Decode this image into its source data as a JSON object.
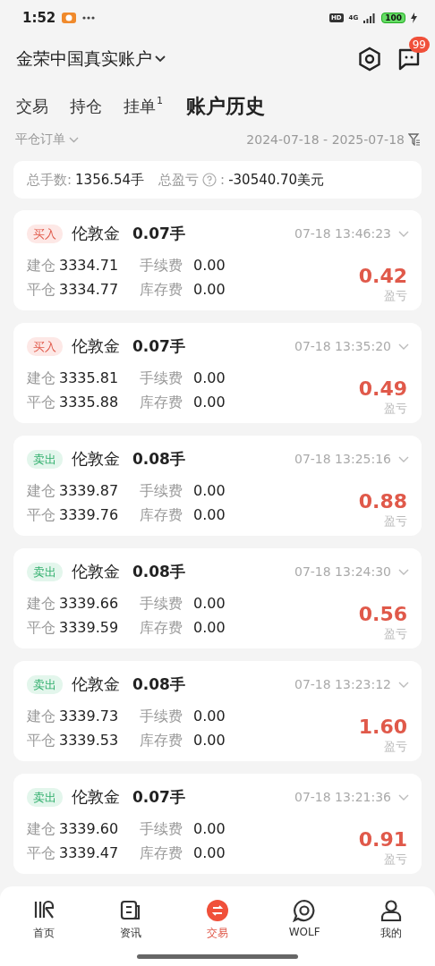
{
  "status_bar": {
    "time": "1:52",
    "hd": "HD",
    "network": "4G",
    "battery": "100"
  },
  "header": {
    "account": "金荣中国真实账户",
    "notification_badge": "99"
  },
  "tabs": [
    {
      "label": "交易",
      "selected": false
    },
    {
      "label": "持仓",
      "selected": false
    },
    {
      "label": "挂单",
      "selected": false,
      "badge": "1"
    },
    {
      "label": "账户历史",
      "selected": true
    }
  ],
  "filter": {
    "order_type": "平仓订单",
    "date_range": "2024-07-18 - 2025-07-18"
  },
  "summary": {
    "lots_label": "总手数:",
    "lots": "1356.54手",
    "pnl_label": "总盈亏",
    "pnl_colon": ":",
    "pnl": "-30540.70美元"
  },
  "orders": [
    {
      "kind": "buy",
      "side": "买入",
      "symbol": "伦敦金",
      "lots": "0.07手",
      "time": "07-18 13:46:23",
      "open_label": "建仓",
      "open_price": "3334.71",
      "fee_label": "手续费",
      "fee": "0.00",
      "close_label": "平仓",
      "close_price": "3334.77",
      "swap_label": "库存费",
      "swap": "0.00",
      "pnl": "0.42",
      "pnl_label": "盈亏"
    },
    {
      "kind": "buy",
      "side": "买入",
      "symbol": "伦敦金",
      "lots": "0.07手",
      "time": "07-18 13:35:20",
      "open_label": "建仓",
      "open_price": "3335.81",
      "fee_label": "手续费",
      "fee": "0.00",
      "close_label": "平仓",
      "close_price": "3335.88",
      "swap_label": "库存费",
      "swap": "0.00",
      "pnl": "0.49",
      "pnl_label": "盈亏"
    },
    {
      "kind": "sell",
      "side": "卖出",
      "symbol": "伦敦金",
      "lots": "0.08手",
      "time": "07-18 13:25:16",
      "open_label": "建仓",
      "open_price": "3339.87",
      "fee_label": "手续费",
      "fee": "0.00",
      "close_label": "平仓",
      "close_price": "3339.76",
      "swap_label": "库存费",
      "swap": "0.00",
      "pnl": "0.88",
      "pnl_label": "盈亏"
    },
    {
      "kind": "sell",
      "side": "卖出",
      "symbol": "伦敦金",
      "lots": "0.08手",
      "time": "07-18 13:24:30",
      "open_label": "建仓",
      "open_price": "3339.66",
      "fee_label": "手续费",
      "fee": "0.00",
      "close_label": "平仓",
      "close_price": "3339.59",
      "swap_label": "库存费",
      "swap": "0.00",
      "pnl": "0.56",
      "pnl_label": "盈亏"
    },
    {
      "kind": "sell",
      "side": "卖出",
      "symbol": "伦敦金",
      "lots": "0.08手",
      "time": "07-18 13:23:12",
      "open_label": "建仓",
      "open_price": "3339.73",
      "fee_label": "手续费",
      "fee": "0.00",
      "close_label": "平仓",
      "close_price": "3339.53",
      "swap_label": "库存费",
      "swap": "0.00",
      "pnl": "1.60",
      "pnl_label": "盈亏"
    },
    {
      "kind": "sell",
      "side": "卖出",
      "symbol": "伦敦金",
      "lots": "0.07手",
      "time": "07-18 13:21:36",
      "open_label": "建仓",
      "open_price": "3339.60",
      "fee_label": "手续费",
      "fee": "0.00",
      "close_label": "平仓",
      "close_price": "3339.47",
      "swap_label": "库存费",
      "swap": "0.00",
      "pnl": "0.91",
      "pnl_label": "盈亏"
    }
  ],
  "bottom_nav": [
    {
      "label": "首页",
      "selected": false
    },
    {
      "label": "资讯",
      "selected": false
    },
    {
      "label": "交易",
      "selected": true
    },
    {
      "label": "WOLF",
      "selected": false
    },
    {
      "label": "我的",
      "selected": false
    }
  ]
}
